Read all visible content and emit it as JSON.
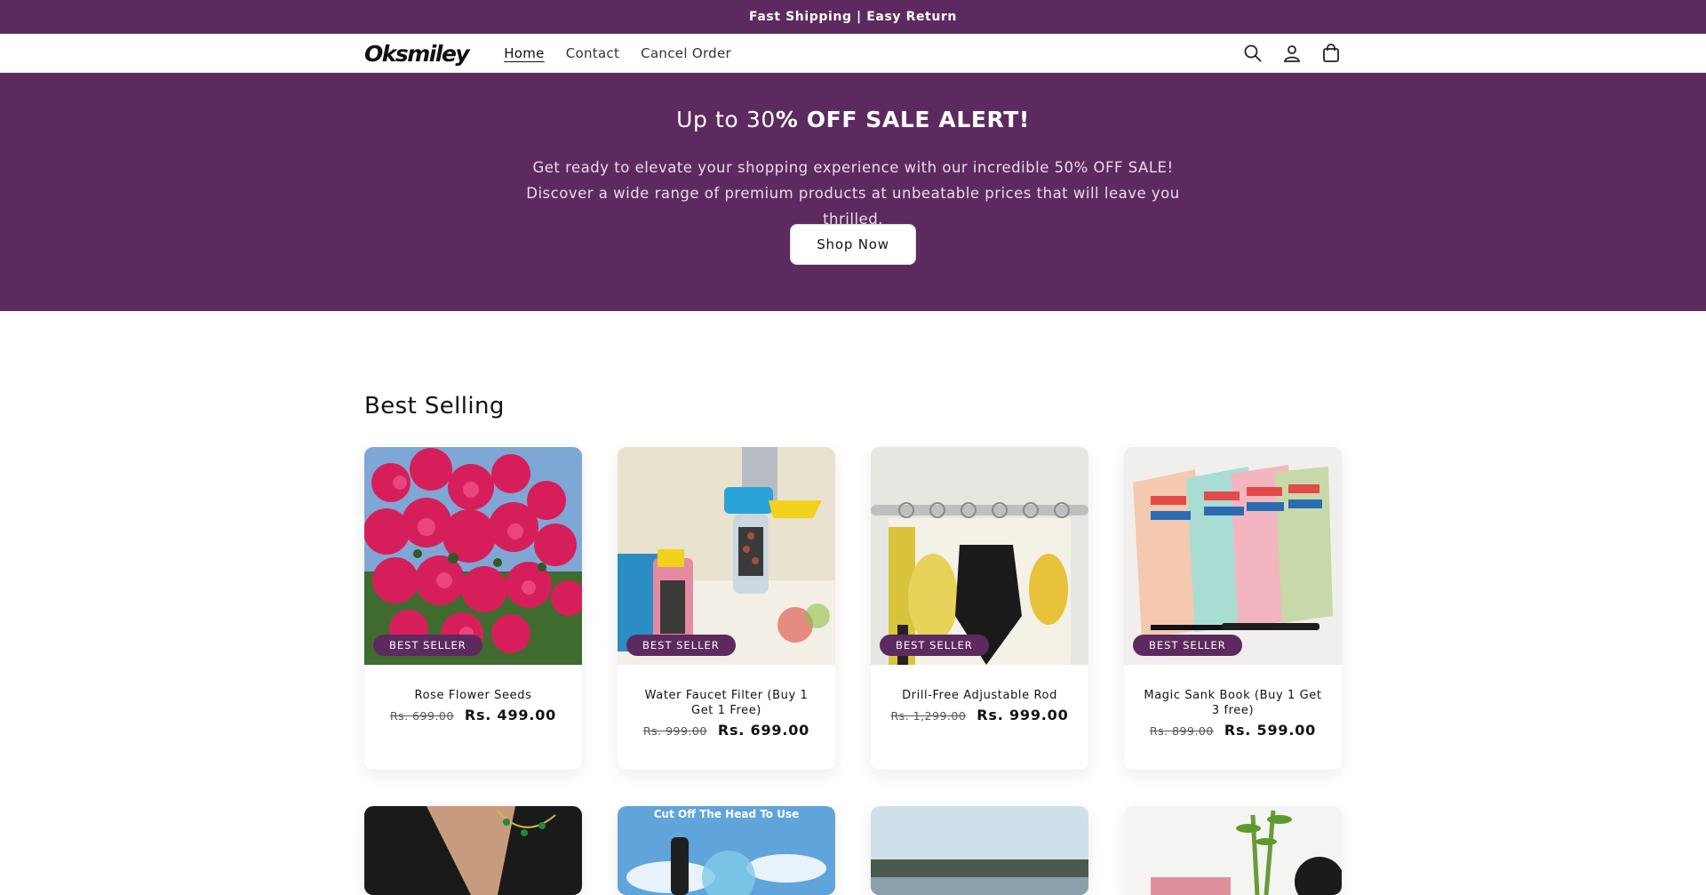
{
  "announcement": "Fast Shipping | Easy Return",
  "header": {
    "logo": "Oksmiley",
    "nav": [
      "Home",
      "Contact",
      "Cancel Order"
    ]
  },
  "hero": {
    "title_normal": "Up to 30",
    "title_bold": "% OFF SALE ALERT!",
    "text": "Get ready to elevate your shopping experience with our incredible 50% OFF SALE!   Discover a wide range of premium products at unbeatable prices that will leave you thrilled.",
    "button": "Shop Now"
  },
  "section": {
    "title": "Best Selling",
    "products": [
      {
        "title": "Rose Flower Seeds",
        "old": "Rs. 699.00",
        "new": "Rs. 499.00",
        "badge": "BEST SELLER"
      },
      {
        "title": "Water Faucet Filter (Buy 1 Get 1 Free)",
        "old": "Rs. 999.00",
        "new": "Rs. 699.00",
        "badge": "BEST SELLER"
      },
      {
        "title": "Drill-Free Adjustable Rod",
        "old": "Rs. 1,299.00",
        "new": "Rs. 999.00",
        "badge": "BEST SELLER"
      },
      {
        "title": "Magic Sank Book (Buy 1 Get 3 free)",
        "old": "Rs. 899.00",
        "new": "Rs. 599.00",
        "badge": "BEST SELLER"
      }
    ],
    "row2_caption": "Cut Off The Head To Use"
  }
}
